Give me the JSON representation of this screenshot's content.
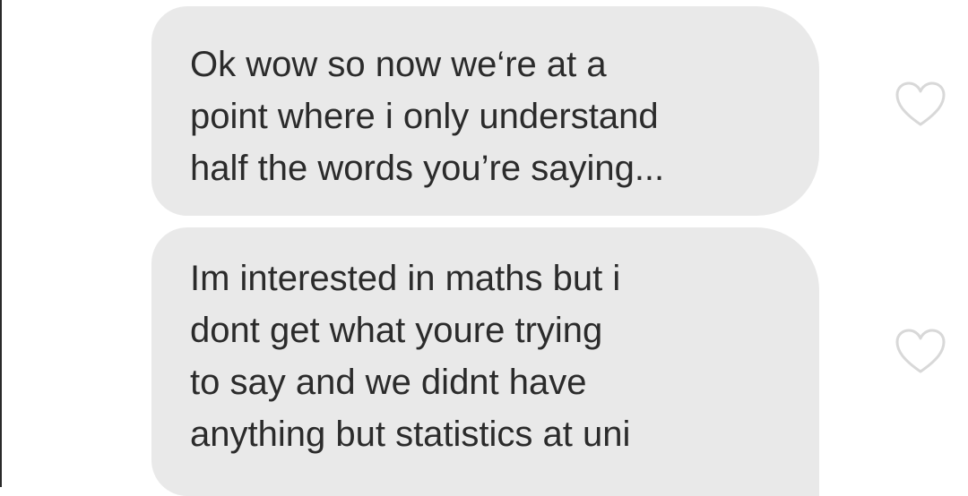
{
  "messages": [
    {
      "lines": [
        "Ok wow so now we‘re at a",
        "point where i only understand",
        "half the words you’re saying..."
      ],
      "like_icon": "heart-outline-icon",
      "liked": false
    },
    {
      "lines": [
        "Im interested in maths but i",
        "dont get what youre trying",
        "to say and we didnt have",
        "anything but statistics at uni"
      ],
      "like_icon": "heart-outline-icon",
      "liked": false
    }
  ],
  "colors": {
    "bubble": "#e9e9e9",
    "text": "#2b2b2b",
    "icon": "#d8d8d8",
    "background": "#ffffff"
  }
}
